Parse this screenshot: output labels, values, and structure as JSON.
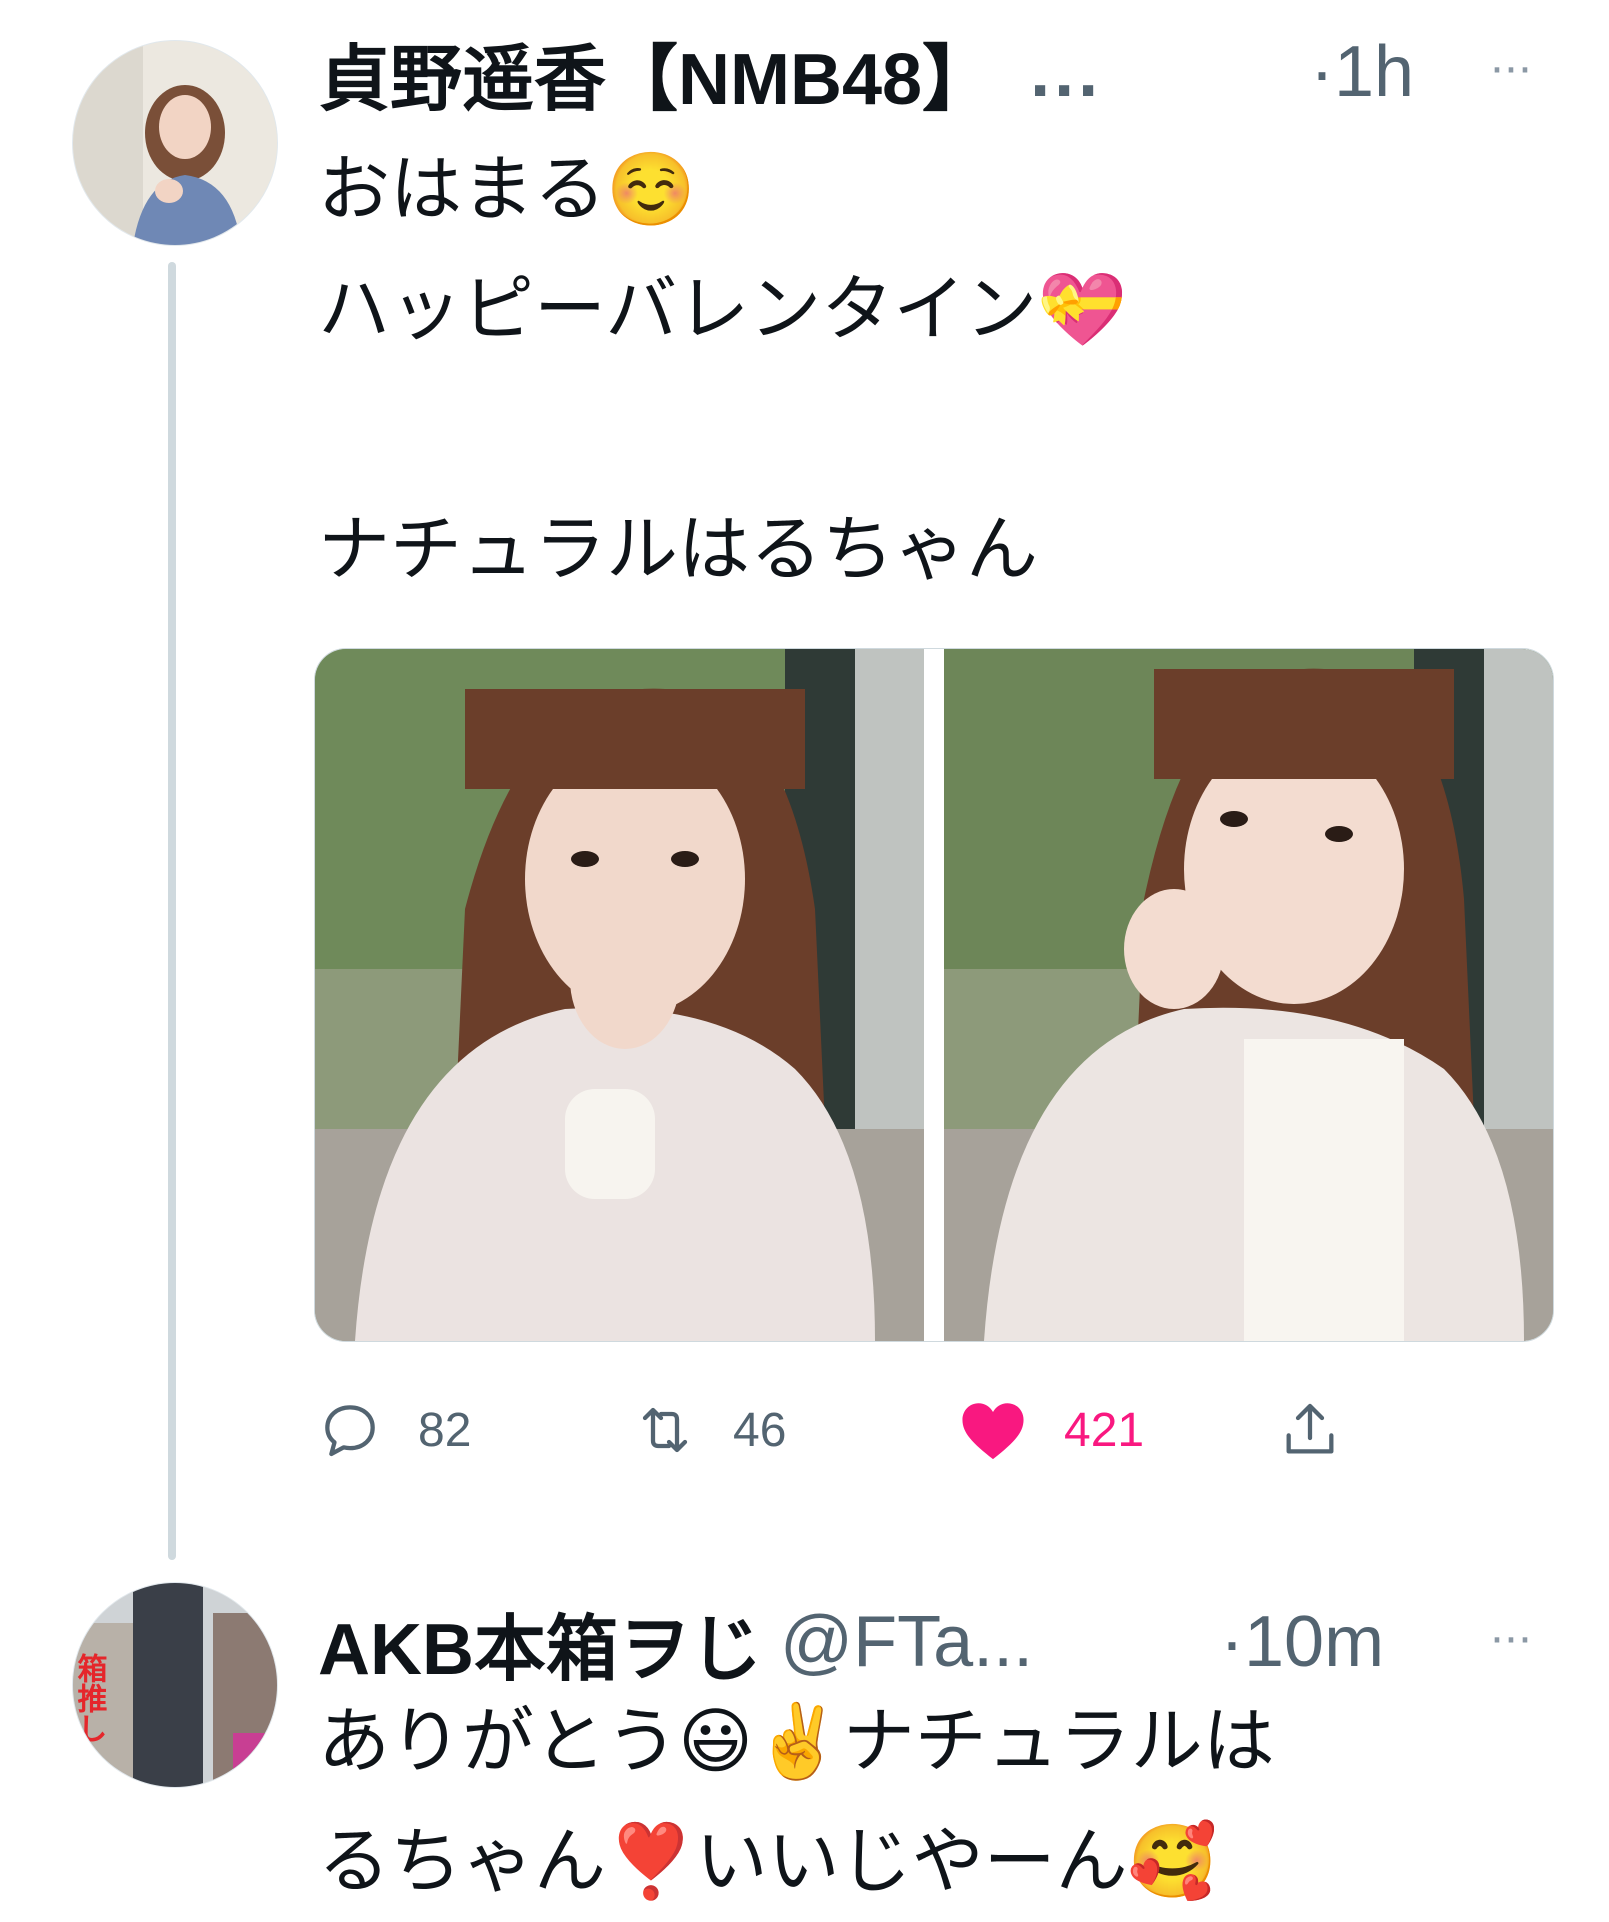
{
  "tweets": [
    {
      "author_name": "貞野遥香【NMB48】",
      "name_truncation": "...",
      "time": "·1h",
      "more_label": "···",
      "text": "おはまる☺️\nハッピーバレンタイン💝\n\nナチュラルはるちゃん",
      "media_count": 2,
      "actions": {
        "reply_count": "82",
        "retweet_count": "46",
        "like_count": "421",
        "liked": true
      },
      "colors": {
        "like": "#f91880",
        "muted": "#536471"
      }
    },
    {
      "author_name": "AKB本箱ヲじ",
      "handle": "@FTa...",
      "time": "·10m",
      "more_label": "···",
      "avatar_text": "箱推し 本店",
      "text": "ありがとう😃✌️ナチュラルは\nるちゃん❣️いいじやーん🥰"
    }
  ]
}
